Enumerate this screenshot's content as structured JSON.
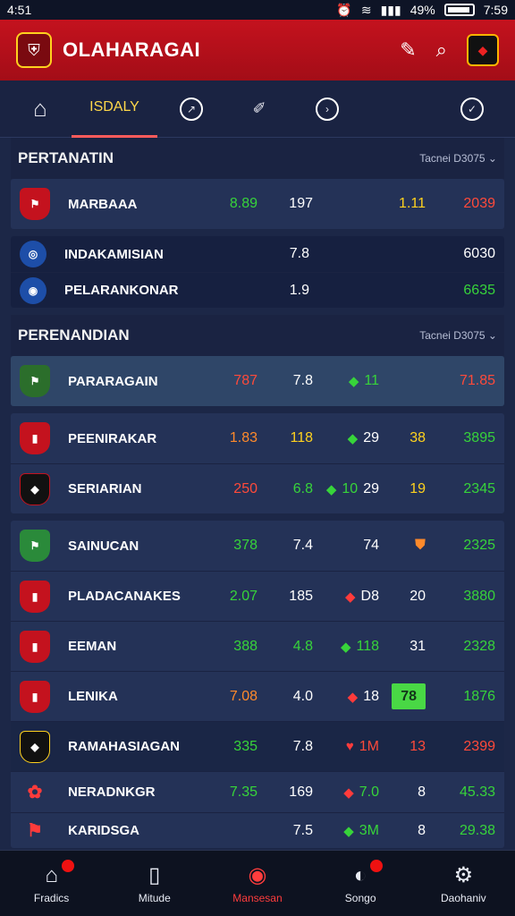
{
  "status": {
    "time": "4:51",
    "battery": "49%",
    "clock": "7:59"
  },
  "header": {
    "title": "OLAHARAGAI"
  },
  "tabs": {
    "daily": "ISDALY"
  },
  "sections": [
    {
      "title": "PERTANATIN",
      "meta": "Tacnei  D3075 ⌄"
    },
    {
      "title": "PERENANDIAN",
      "meta": "Tacnei  D3075 ⌄"
    }
  ],
  "rows": [
    {
      "team": "MARBAAA",
      "c1": "8.89",
      "c2": "197",
      "c3": "",
      "c4": "1.11",
      "c5": "2039",
      "badge_color": "#c4121e"
    },
    {
      "team": "INDAKAMISIAN",
      "c1": "",
      "c2": "7.8",
      "c3": "",
      "c4": "",
      "c5": "6030",
      "badge_color": "#1d4ea8"
    },
    {
      "team": "PELARANKONAR",
      "c1": "",
      "c2": "1.9",
      "c3": "",
      "c4": "",
      "c5": "6635",
      "badge_color": "#1d4ea8"
    },
    {
      "team": "PARARAGAIN",
      "c1": "787",
      "c2": "7.8",
      "c3": "11",
      "c4": "",
      "c5": "71.85",
      "badge_color": "#2b6e2b"
    },
    {
      "team": "PEENIRAKAR",
      "c1": "1.83",
      "c2": "118",
      "c3": "",
      "c4": "29",
      "c5": "3895",
      "c4b": "38",
      "badge_color": "#c4121e"
    },
    {
      "team": "SERIARIAN",
      "c1": "250",
      "c2": "6.8",
      "c3": "10",
      "c4": "29",
      "c5": "2345",
      "c4b": "19",
      "badge_color": "#111111"
    },
    {
      "team": "SAINUCAN",
      "c1": "378",
      "c2": "7.4",
      "c3": "74",
      "c4": "",
      "c5": "2325",
      "badge_color": "#2a8a3a"
    },
    {
      "team": "PLADACANAKES",
      "c1": "2.07",
      "c2": "185",
      "c3": "D8",
      "c4": "20",
      "c5": "3880",
      "badge_color": "#c4121e"
    },
    {
      "team": "EEMAN",
      "c1": "388",
      "c2": "4.8",
      "c3": "118",
      "c4": "31",
      "c5": "2328",
      "badge_color": "#c4121e"
    },
    {
      "team": "LENIKA",
      "c1": "7.08",
      "c2": "4.0",
      "c3": "18",
      "c4": "78",
      "c5": "1876",
      "badge_color": "#c4121e"
    },
    {
      "team": "RAMAHASIAGAN",
      "c1": "335",
      "c2": "7.8",
      "c3": "1M",
      "c4": "13",
      "c5": "2399",
      "badge_color": "#111111"
    },
    {
      "team": "NERADNKGR",
      "c1": "7.35",
      "c2": "169",
      "c3": "7.0",
      "c4": "8",
      "c5": "45.33",
      "badge_color": "#c4121e"
    },
    {
      "team": "KARIDSGA",
      "c1": "",
      "c2": "7.5",
      "c3": "3M",
      "c4": "8",
      "c5": "29.38",
      "badge_color": "#c4121e"
    }
  ],
  "bottom_nav": [
    {
      "label": "Fradics"
    },
    {
      "label": "Mitude"
    },
    {
      "label": "Mansesan"
    },
    {
      "label": "Songo"
    },
    {
      "label": "Daohaniv"
    }
  ],
  "colors": {
    "header_red": "#c4121e",
    "bg_navy": "#1c2747",
    "accent_green": "#37d43a",
    "accent_red": "#ff4a3a",
    "accent_yellow": "#ffd21e"
  }
}
